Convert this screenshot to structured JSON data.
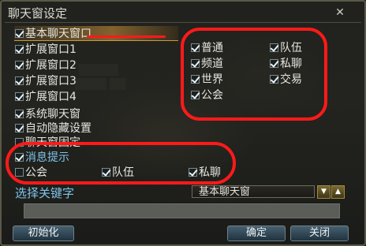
{
  "window": {
    "title": "聊天窗设定",
    "close_glyph": "✕"
  },
  "left_options": [
    {
      "label": "基本聊天窗口",
      "checked": true
    },
    {
      "label": "扩展窗口1",
      "checked": true
    },
    {
      "label": "扩展窗口2",
      "checked": true
    },
    {
      "label": "扩展窗口3",
      "checked": true
    },
    {
      "label": "扩展窗口4",
      "checked": true
    }
  ],
  "channels": [
    {
      "label": "普通",
      "checked": true
    },
    {
      "label": "队伍",
      "checked": true
    },
    {
      "label": "频道",
      "checked": true
    },
    {
      "label": "私聊",
      "checked": true
    },
    {
      "label": "世界",
      "checked": true
    },
    {
      "label": "交易",
      "checked": true
    },
    {
      "label": "公会",
      "checked": true
    }
  ],
  "settings": [
    {
      "label": "系统聊天窗",
      "checked": true
    },
    {
      "label": "自动隐藏设置",
      "checked": true
    },
    {
      "label": "聊天窗固定",
      "checked": false
    }
  ],
  "notify": {
    "label": "消息提示",
    "options": [
      {
        "label": "公会",
        "checked": false
      },
      {
        "label": "队伍",
        "checked": true
      },
      {
        "label": "私聊",
        "checked": true
      }
    ]
  },
  "keyword": {
    "label": "选择关键字",
    "dropdown_value": "基本聊天窗",
    "up_icon": "▼",
    "down_icon": "▲"
  },
  "buttons": {
    "reset": "初始化",
    "ok": "确定",
    "close": "关闭"
  }
}
